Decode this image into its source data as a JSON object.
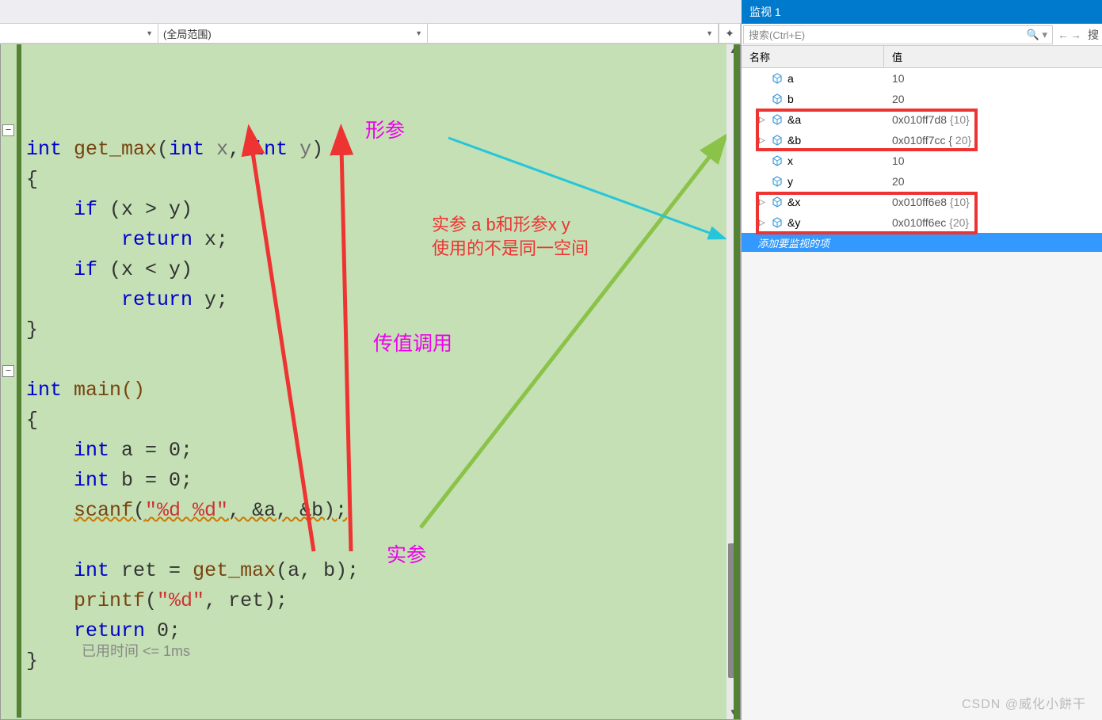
{
  "toolbar": {
    "scope_label": "(全局范围)"
  },
  "code": {
    "lines": {
      "l1_int": "int",
      "l1_fn": " get_max",
      "l1_paren": "(",
      "l1_intx": "int",
      "l1_x": " x",
      "l1_comma": ", ",
      "l1_inty": "int",
      "l1_y": " y",
      "l1_close": ")",
      "l2": "{",
      "l3_if": "    if",
      "l3_cond": " (x > y)",
      "l4_ret": "        return",
      "l4_x": " x;",
      "l5_if": "    if",
      "l5_cond": " (x < y)",
      "l6_ret": "        return",
      "l6_y": " y;",
      "l7": "}",
      "l9_int": "int",
      "l9_main": " main()",
      "l10": "{",
      "l11_int": "    int",
      "l11_rest": " a = 0;",
      "l12_int": "    int",
      "l12_rest": " b = 0;",
      "l13_scanf_fn": "scanf",
      "l13_scanf_args_str": "\"%d %d\"",
      "l13_scanf_args_rest": ", &a, &b);",
      "l14_int": "    int",
      "l14_ret": " ret = ",
      "l14_fn": "get_max",
      "l14_args": "(a, b);",
      "l15_fn": "    printf",
      "l15_args_open": "(",
      "l15_args_str": "\"%d\"",
      "l15_args_rest": ", ret);",
      "l16_ret": "    return",
      "l16_val": " 0;",
      "l17": "}"
    },
    "timing": "已用时间 <= 1ms"
  },
  "annotations": {
    "formal_params": "形参",
    "call_by_value": "传值调用",
    "actual_params": "实参",
    "note_line1": "实参 a b和形参x y",
    "note_line2": "使用的不是同一空间"
  },
  "watch": {
    "title": "监视 1",
    "search_placeholder": "搜索(Ctrl+E)",
    "search_truncated": "搜",
    "col_name": "名称",
    "col_value": "值",
    "rows": [
      {
        "name": "a",
        "value": "10",
        "expandable": false
      },
      {
        "name": "b",
        "value": "20",
        "expandable": false
      },
      {
        "name": "&a",
        "value": "0x010ff7d8",
        "suffix": "{10}",
        "expandable": true
      },
      {
        "name": "&b",
        "value": "0x010ff7cc {",
        "suffix": "20}",
        "expandable": true
      },
      {
        "name": "x",
        "value": "10",
        "expandable": false
      },
      {
        "name": "y",
        "value": "20",
        "expandable": false
      },
      {
        "name": "&x",
        "value": "0x010ff6e8",
        "suffix": "{10}",
        "expandable": true
      },
      {
        "name": "&y",
        "value": "0x010ff6ec",
        "suffix": "{20}",
        "expandable": true
      }
    ],
    "add_item": "添加要监视的项"
  },
  "watermark": "CSDN @威化小餅干"
}
